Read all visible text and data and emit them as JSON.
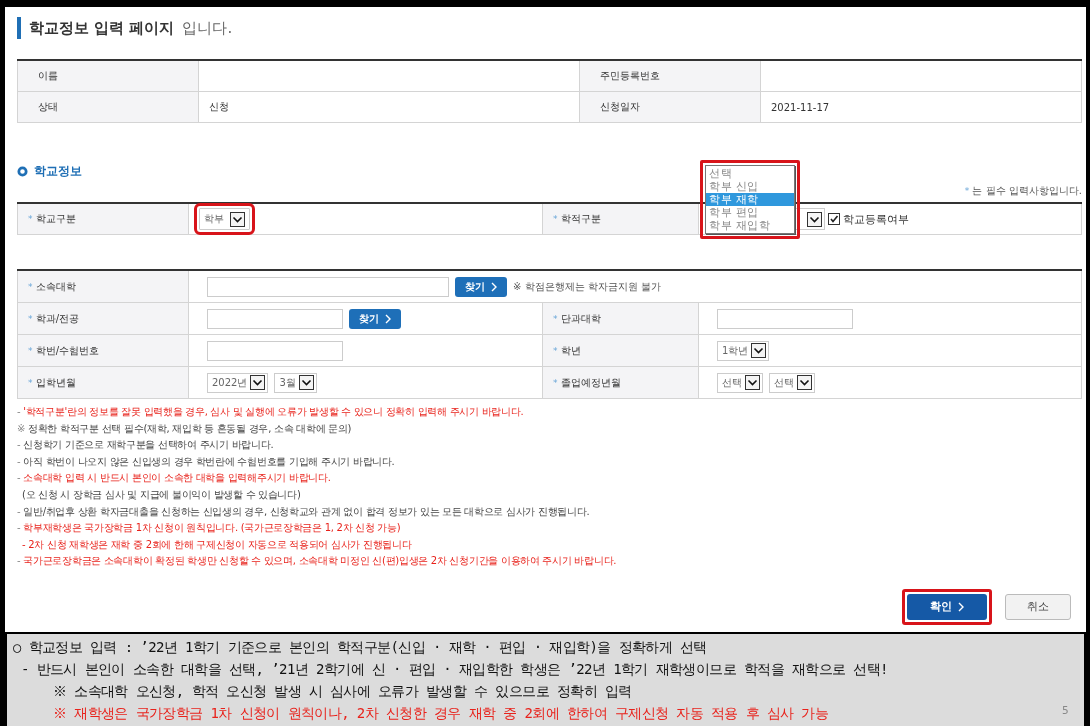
{
  "page_title": {
    "bold": "학교정보 입력 페이지",
    "rest": "입니다."
  },
  "applicant_table": [
    [
      {
        "label": "이름"
      },
      {
        "label": "주민등록번호"
      }
    ],
    [
      {
        "label": "상태",
        "value": "신청"
      },
      {
        "label": "신청일자",
        "value": "2021-11-17"
      }
    ]
  ],
  "section_title": "학교정보",
  "required_note": {
    "mark": "*",
    "text": "는 필수 입력사항입니다."
  },
  "school_type": {
    "label": "학교구분",
    "value": "학부",
    "highlighted": true
  },
  "enrollment": {
    "label": "학적구분",
    "highlighted": true,
    "options": [
      {
        "label": "선택",
        "selected": false
      },
      {
        "label": "학부 신입",
        "selected": false
      },
      {
        "label": "학부 재학",
        "selected": true
      },
      {
        "label": "학부 편입",
        "selected": false
      },
      {
        "label": "학부 재입학",
        "selected": false
      }
    ],
    "checkbox": {
      "label": "학교등록여부",
      "checked": true
    }
  },
  "university": {
    "label": "소속대학",
    "button": "찾기",
    "note": "※ 학점은행제는 학자금지원 불가"
  },
  "rows": [
    [
      {
        "label": "학과/전공",
        "kind": "field",
        "button": "찾기"
      },
      {
        "label": "단과대학",
        "kind": "field"
      }
    ],
    [
      {
        "label": "학번/수험번호",
        "kind": "field"
      },
      {
        "label": "학년",
        "kind": "select",
        "selects": [
          "1학년"
        ]
      }
    ],
    [
      {
        "label": "입학년월",
        "kind": "select",
        "selects": [
          "2022년",
          "3월"
        ]
      },
      {
        "label": "졸업예정년월",
        "kind": "select",
        "selects": [
          "선택",
          "선택"
        ]
      }
    ]
  ],
  "notices": [
    {
      "marker": "-",
      "text": "'학적구분'란의 정보를 잘못 입력했을 경우, 심사 및 실행에 오류가 발생할 수 있으니 정확히 입력해 주시기 바랍니다.",
      "kind": "warning"
    },
    {
      "marker": "※",
      "text": "정확한 학적구분 선택 필수(재학, 재입학 등 혼동될 경우, 소속 대학에 문의)",
      "kind": "info"
    },
    {
      "marker": "-",
      "text": "신청학기 기준으로 재학구분을 선택하여 주시기 바랍니다.",
      "kind": "info"
    },
    {
      "marker": "-",
      "text": "아직 학번이 나오지 않은 신입생의 경우 학번란에 수험번호를 기입해 주시기 바랍니다.",
      "kind": "info"
    },
    {
      "marker": "-",
      "text": "소속대학 입력 시 반드시 본인이 소속한 대학을 입력해주시기 바랍니다.",
      "kind": "warning"
    },
    {
      "text": "(오 신청 시 장학금 심사 및 지급에 불이익이 발생할 수 있습니다)",
      "kind": "info"
    },
    {
      "marker": "-",
      "text": "일반/취업후 상환 학자금대출을 신청하는 신입생의 경우, 신청학교와 관계 없이 합격 정보가 있는 모든 대학으로 심사가 진행됩니다.",
      "kind": "info"
    },
    {
      "marker": "-",
      "text": "학부재학생은 국가장학금 1차 신청이 원칙입니다. (국가근로장학금은 1, 2차 신청 가능)",
      "kind": "warning"
    },
    {
      "text": "- 2차 신청 재학생은 재학 중 2회에 한해 구제신청이 자동으로 적용되어 심사가 진행됩니다",
      "kind": "warning"
    },
    {
      "marker": "-",
      "text": "국가근로장학금은 소속대학이 확정된 학생만 신청할 수 있으며, 소속대학 미정인 신(편)입생은 2차 신청기간을 이용하여 주시기 바랍니다.",
      "kind": "warning"
    }
  ],
  "buttons": [
    {
      "label": "확인",
      "kind": "primary",
      "highlighted": true
    },
    {
      "label": "취소",
      "kind": "secondary",
      "highlighted": false
    }
  ],
  "slide_notes": [
    {
      "text": "○ 학교정보 입력 : ’22년 1학기 기준으로 본인의 학적구분(신입 · 재학 · 편입 · 재입학)을 정확하게 선택",
      "kind": "normal",
      "children": [
        {
          "text": "- 반드시 본인이 소속한 대학을 선택, ’21년 2학기에 신 · 편입 · 재입학한 학생은 ’22년 1학기 재학생이므로 학적을 재학으로 선택!",
          "kind": "normal",
          "children": [
            {
              "text": "※ 소속대학 오신청, 학적 오신청 발생 시 심사에 오류가 발생할 수 있으므로 정확히 입력",
              "kind": "normal"
            },
            {
              "text": "※ 재학생은 국가장학금 1차 신청이 원칙이나, 2차 신청한 경우 재학 중 2회에 한하여 구제신청 자동 적용 후 심사 가능",
              "kind": "warning"
            }
          ]
        }
      ]
    }
  ],
  "page_number": "5"
}
